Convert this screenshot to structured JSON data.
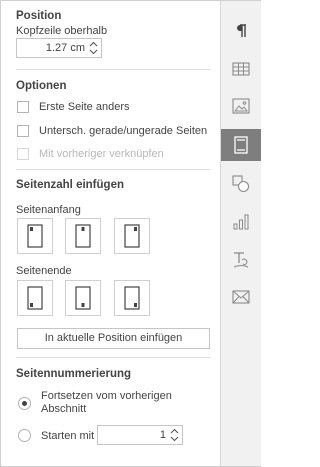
{
  "position": {
    "heading": "Position",
    "header_offset_label": "Kopfzeile oberhalb",
    "header_offset_value": "1.27 cm"
  },
  "options": {
    "heading": "Optionen",
    "first_page_label": "Erste Seite anders",
    "odd_even_label": "Untersch. gerade/ungerade Seiten",
    "link_previous_label": "Mit vorheriger verknüpfen"
  },
  "page_number": {
    "heading": "Seitenzahl einfügen",
    "top_label": "Seitenanfang",
    "bottom_label": "Seitenende",
    "insert_button": "In aktuelle Position einfügen"
  },
  "numbering": {
    "heading": "Seitennummerierung",
    "continue_label": "Fortsetzen vom vorherigen Abschnitt",
    "continue_line1": "Fortsetzen vom vorherigen",
    "continue_line2": "Abschnitt",
    "start_label": "Starten mit",
    "start_value": "1",
    "selected": "continue"
  },
  "sidebar": {
    "items": [
      {
        "icon": "paragraph-icon",
        "active": false
      },
      {
        "icon": "table-icon",
        "active": false
      },
      {
        "icon": "image-icon",
        "active": false
      },
      {
        "icon": "header-footer-icon",
        "active": true
      },
      {
        "icon": "shape-icon",
        "active": false
      },
      {
        "icon": "chart-icon",
        "active": false
      },
      {
        "icon": "text-art-icon",
        "active": false
      },
      {
        "icon": "mail-merge-icon",
        "active": false
      }
    ]
  },
  "colors": {
    "active_tab": "#7e7e7e",
    "sidebar_bg": "#f1f1f1",
    "text": "#444444",
    "disabled_text": "#b8b8b8"
  }
}
